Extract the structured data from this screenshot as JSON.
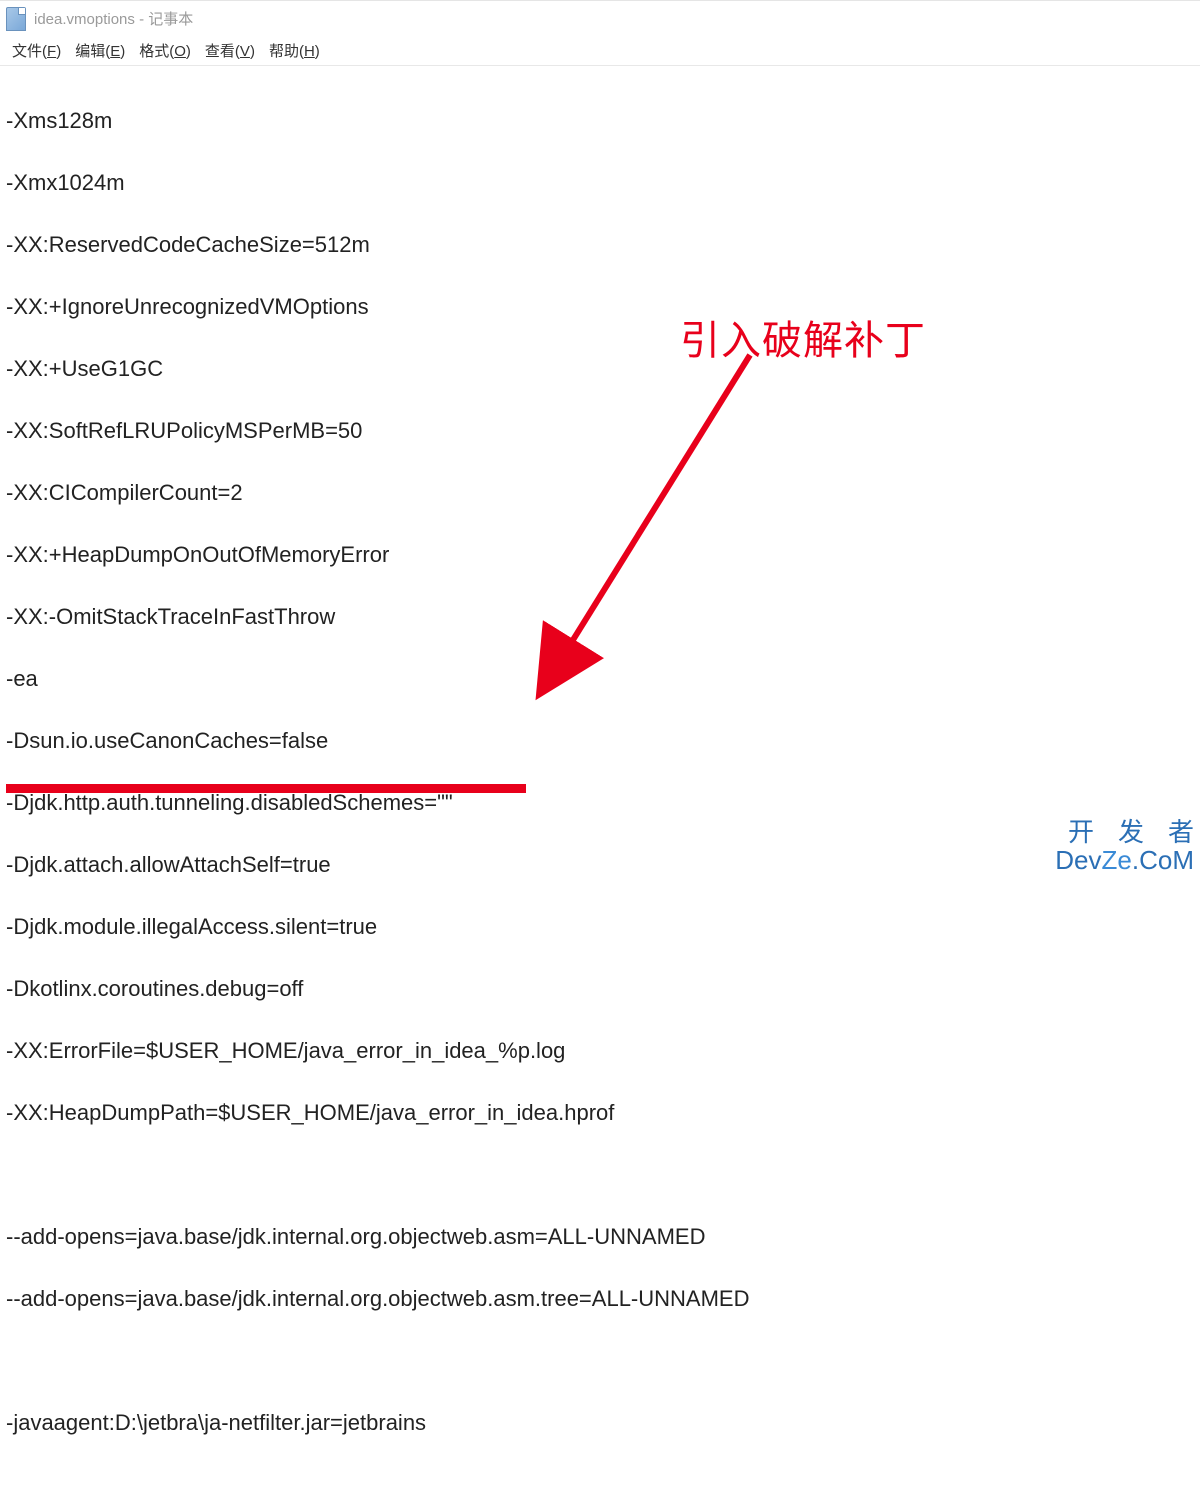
{
  "title_bar": {
    "filename": "idea.vmoptions",
    "sep": " - ",
    "app_name": "记事本"
  },
  "menu": {
    "file": {
      "text": "文件",
      "accel": "F"
    },
    "edit": {
      "text": "编辑",
      "accel": "E"
    },
    "format": {
      "text": "格式",
      "accel": "O"
    },
    "view": {
      "text": "查看",
      "accel": "V"
    },
    "help": {
      "text": "帮助",
      "accel": "H"
    }
  },
  "content_lines": [
    "-Xms128m",
    "-Xmx1024m",
    "-XX:ReservedCodeCacheSize=512m",
    "-XX:+IgnoreUnrecognizedVMOptions",
    "-XX:+UseG1GC",
    "-XX:SoftRefLRUPolicyMSPerMB=50",
    "-XX:CICompilerCount=2",
    "-XX:+HeapDumpOnOutOfMemoryError",
    "-XX:-OmitStackTraceInFastThrow",
    "-ea",
    "-Dsun.io.useCanonCaches=false",
    "-Djdk.http.auth.tunneling.disabledSchemes=\"\"",
    "-Djdk.attach.allowAttachSelf=true",
    "-Djdk.module.illegalAccess.silent=true",
    "-Dkotlinx.coroutines.debug=off",
    "-XX:ErrorFile=$USER_HOME/java_error_in_idea_%p.log",
    "-XX:HeapDumpPath=$USER_HOME/java_error_in_idea.hprof",
    "",
    "--add-opens=java.base/jdk.internal.org.objectweb.asm=ALL-UNNAMED",
    "--add-opens=java.base/jdk.internal.org.objectweb.asm.tree=ALL-UNNAMED",
    "",
    "-javaagent:D:\\jetbra\\ja-netfilter.jar=jetbrains"
  ],
  "annotation": {
    "text": "引入破解补丁",
    "color_hex": "#e8001b"
  },
  "watermark": {
    "line1": "开发者",
    "line2_a": "Dev",
    "line2_b": "Ze",
    "line2_c": ".CoM"
  }
}
